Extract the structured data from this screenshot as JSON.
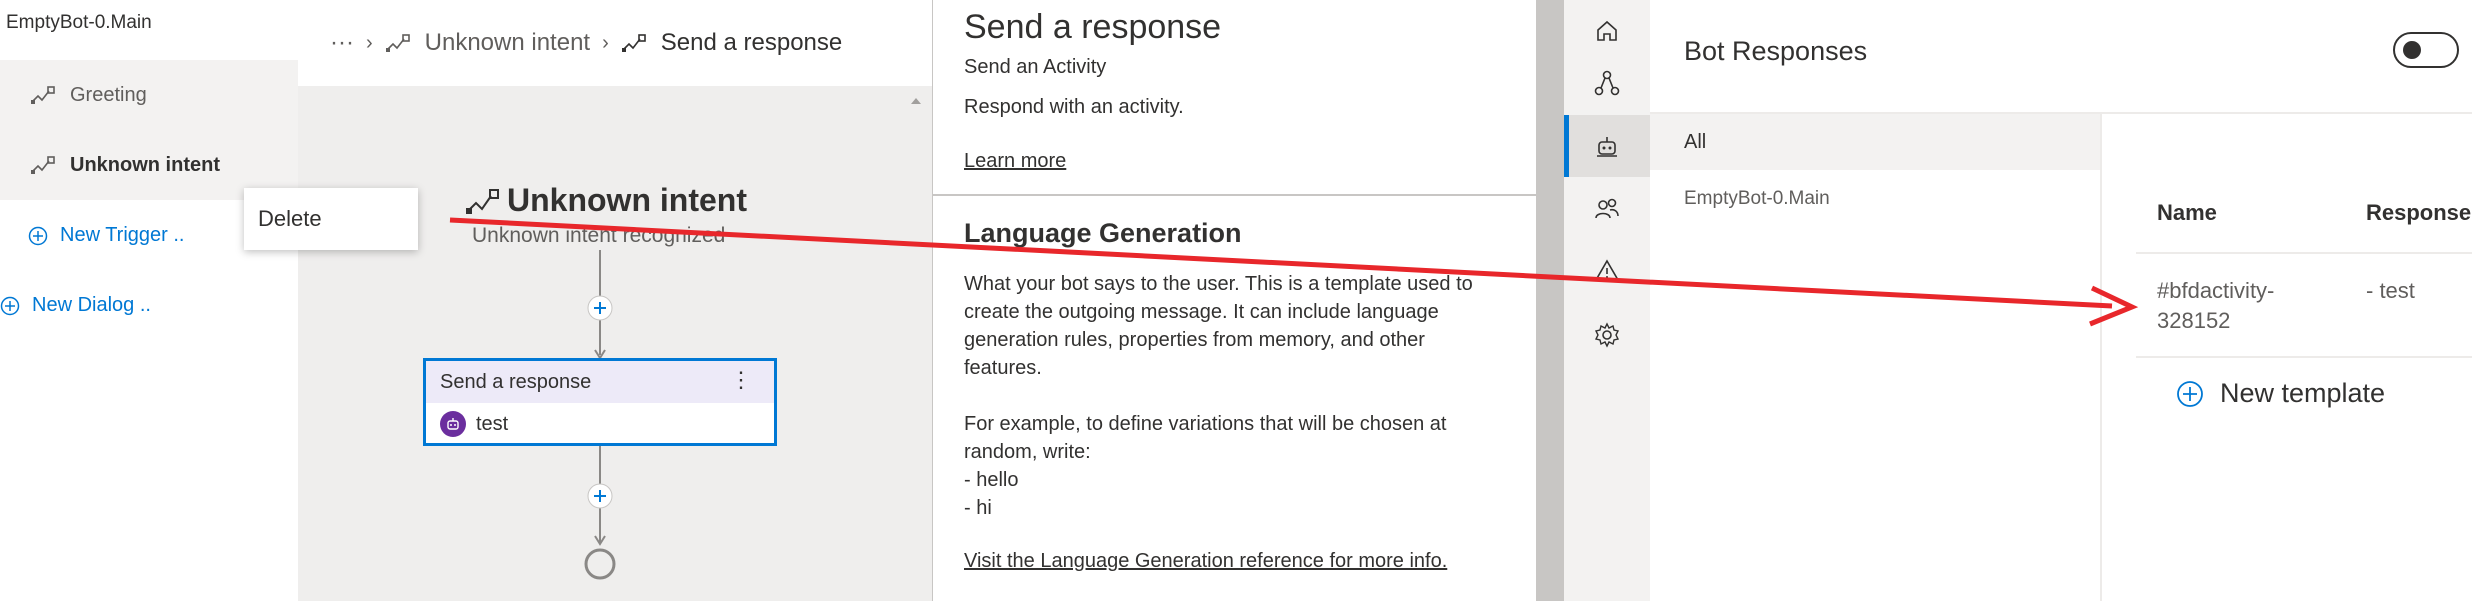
{
  "nav": {
    "dialog_title": "EmptyBot-0.Main",
    "triggers": [
      {
        "label": "Greeting"
      },
      {
        "label": "Unknown intent"
      }
    ],
    "new_trigger": "New Trigger ..",
    "new_dialog": "New Dialog .."
  },
  "context_menu": {
    "delete": "Delete"
  },
  "breadcrumb": {
    "more": "···",
    "items": [
      "Unknown intent",
      "Send a response"
    ]
  },
  "canvas": {
    "node_title": "Unknown intent",
    "node_subtitle": "Unknown intent recognized",
    "action_title": "Send a response",
    "action_more": "⋮",
    "action_value": "test"
  },
  "properties": {
    "title": "Send a response",
    "subtitle": "Send an Activity",
    "description": "Respond with an activity.",
    "learn_more": "Learn more",
    "lg_title": "Language Generation",
    "lg_lines": [
      "What your bot says to the user. This is a template used to",
      "create the outgoing message. It can include language",
      "generation rules, properties from memory, and other",
      "features."
    ],
    "example_lines": [
      "For example, to define variations that will be chosen at",
      "random, write:",
      "- hello",
      "- hi"
    ],
    "reference_link": "Visit the Language Generation reference for more info."
  },
  "bot_responses": {
    "title": "Bot Responses",
    "list": {
      "all": "All",
      "item": "EmptyBot-0.Main"
    },
    "columns": {
      "name": "Name",
      "responses": "Response"
    },
    "rows": [
      {
        "name_line1": "#bfdactivity-",
        "name_line2": "328152",
        "response": "- test"
      }
    ],
    "new_template": "New template"
  },
  "colors": {
    "accent": "#0078d4",
    "arrow": "#e8272b",
    "bot_icon": "#6b2e9e"
  }
}
